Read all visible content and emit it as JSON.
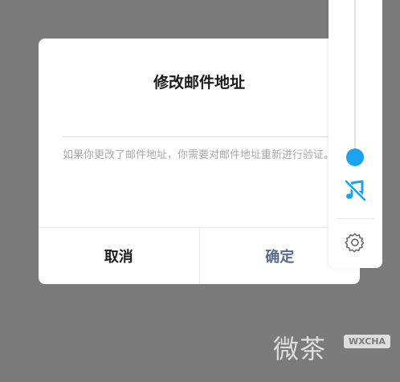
{
  "dialog": {
    "title": "修改邮件地址",
    "email_value": "",
    "hint": "如果你更改了邮件地址，你需要对邮件地址重新进行验证。",
    "cancel_label": "取消",
    "confirm_label": "确定"
  },
  "side_panel": {
    "slider_level": 0.0,
    "accent_color": "#18a2f0",
    "icons": [
      "music-off-icon",
      "gear-icon"
    ]
  },
  "watermark": {
    "chars": "微茶",
    "badge": "WXCHA"
  }
}
